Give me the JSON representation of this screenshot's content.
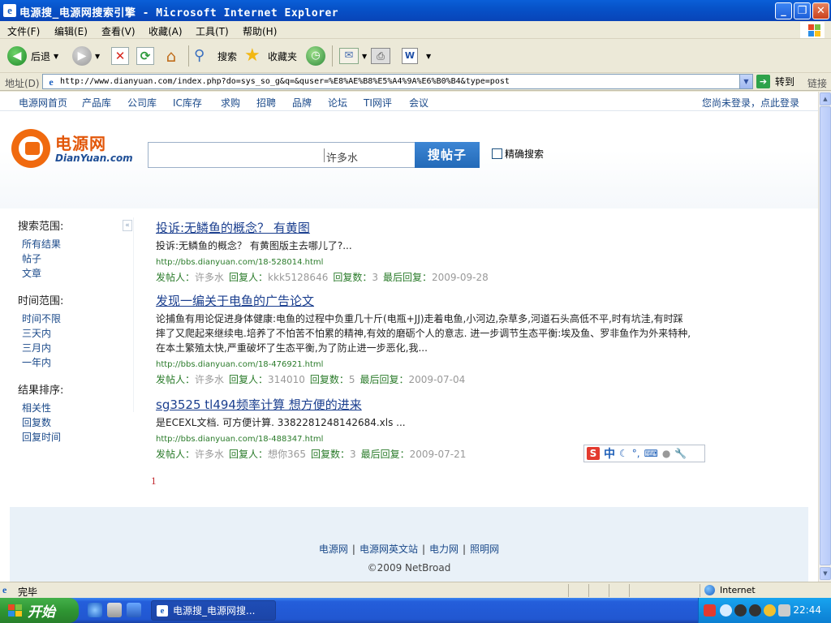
{
  "window": {
    "title": "电源搜_电源网搜索引擎 - Microsoft Internet Explorer"
  },
  "menu": [
    "文件(F)",
    "编辑(E)",
    "查看(V)",
    "收藏(A)",
    "工具(T)",
    "帮助(H)"
  ],
  "toolbar": {
    "back": "后退",
    "search": "搜索",
    "favorites": "收藏夹"
  },
  "address": {
    "label": "地址(D)",
    "url": "http://www.dianyuan.com/index.php?do=sys_so_g&q=&quser=%E8%AE%B8%E5%A4%9A%E6%B0%B4&type=post",
    "go": "转到",
    "links": "链接"
  },
  "topnav": {
    "items": [
      "电源网首页",
      "产品库",
      "公司库",
      "IC库存",
      "求购",
      "招聘",
      "品牌",
      "论坛",
      "TI网评",
      "会议"
    ],
    "login": "您尚未登录，点此登录"
  },
  "logo": {
    "cn": "电源网",
    "en": "DianYuan.com"
  },
  "search": {
    "value": "许多水",
    "button": "搜帖子",
    "exact": "精确搜索"
  },
  "sidebar": {
    "scope_title": "搜索范围:",
    "scope": [
      "所有结果",
      "帖子",
      "文章"
    ],
    "time_title": "时间范围:",
    "time": [
      "时间不限",
      "三天内",
      "三月内",
      "一年内"
    ],
    "sort_title": "结果排序:",
    "sort": [
      "相关性",
      "回复数",
      "回复时间"
    ],
    "collapse": "«"
  },
  "meta_labels": {
    "poster": "发帖人：",
    "replier": "回复人：",
    "replies": "回复数：",
    "last_reply": "最后回复："
  },
  "results": [
    {
      "title": "投诉:无鳞鱼的概念？ 有黄图",
      "snippet": "投诉:无鳞鱼的概念？ 有黄图版主去哪儿了?...",
      "url": "http://bbs.dianyuan.com/18-528014.html",
      "poster": "许多水",
      "replier": "kkk5128646",
      "replies": "3",
      "last_reply": "2009-09-28"
    },
    {
      "title": "发现一编关于电鱼的广告论文",
      "snippet": "论捕鱼有用论促进身体健康:电鱼的过程中负重几十斤(电瓶+JJ)走着电鱼,小河边,杂草多,河道石头高低不平,时有坑洼,有时踩摔了又爬起来继续电.培养了不怕苦不怕累的精神,有效的磨砺个人的意志. 进一步调节生态平衡:埃及鱼、罗非鱼作为外来特种,在本土繁殖太快,严重破坏了生态平衡,为了防止进一步恶化,我...",
      "url": "http://bbs.dianyuan.com/18-476921.html",
      "poster": "许多水",
      "replier": "314010",
      "replies": "5",
      "last_reply": "2009-07-04"
    },
    {
      "title": "sg3525 tl494频率计算 想方便的进来",
      "snippet": "是ECEXL文档. 可方便计算. 3382281248142684.xls ...",
      "url": "http://bbs.dianyuan.com/18-488347.html",
      "poster": "许多水",
      "replier": "想你365",
      "replies": "3",
      "last_reply": "2009-07-21"
    }
  ],
  "pagination": {
    "current": "1"
  },
  "ime": {
    "logo": "S",
    "lang": "中"
  },
  "footer": {
    "links": [
      "电源网",
      "电源网英文站",
      "电力网",
      "照明网"
    ],
    "copyright": "©2009 NetBroad"
  },
  "status": {
    "text": "完毕",
    "zone": "Internet"
  },
  "taskbar": {
    "start": "开始",
    "task": "电源搜_电源网搜...",
    "clock": "22:44"
  }
}
